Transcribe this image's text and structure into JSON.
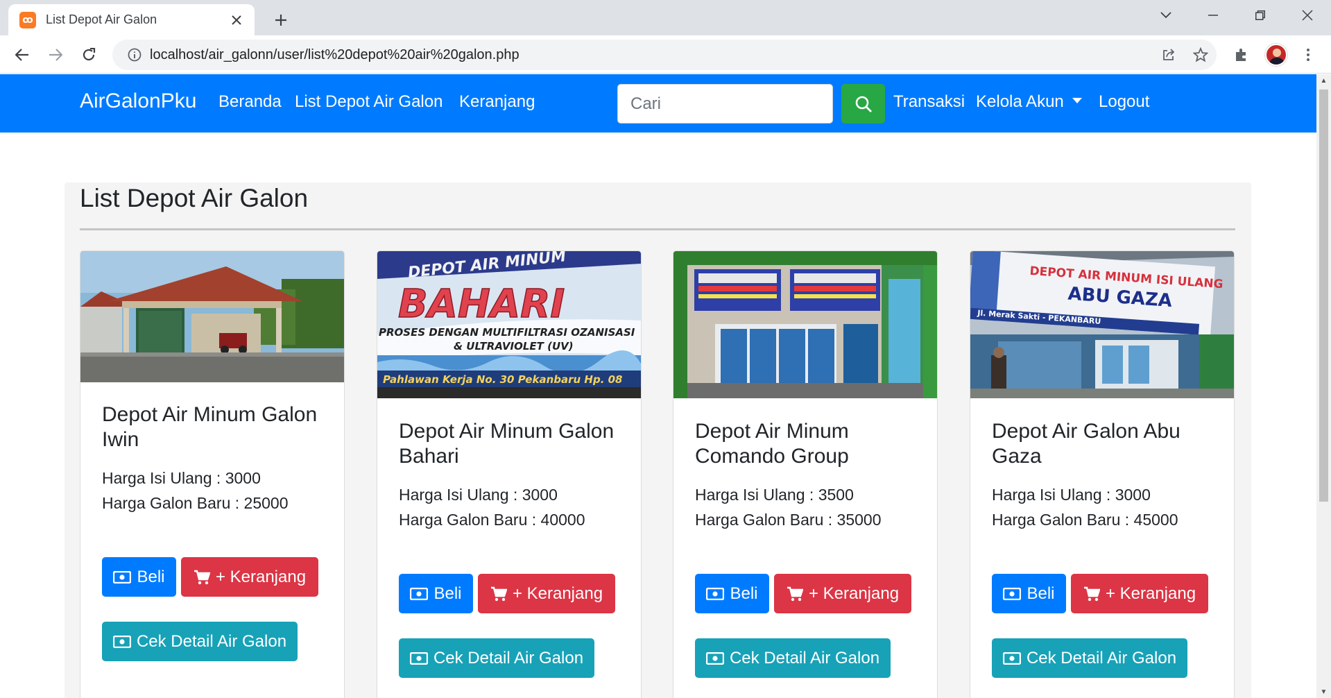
{
  "browser": {
    "tab_title": "List Depot Air Galon",
    "url": "localhost/air_galonn/user/list%20depot%20air%20galon.php"
  },
  "site": {
    "brand": "AirGalonPku",
    "nav": {
      "beranda": "Beranda",
      "list_depot": "List Depot Air Galon",
      "keranjang": "Keranjang",
      "transaksi": "Transaksi",
      "kelola_akun": "Kelola Akun",
      "logout": "Logout"
    },
    "search": {
      "placeholder": "Cari"
    }
  },
  "page": {
    "title": "List Depot Air Galon",
    "buttons": {
      "beli": "Beli",
      "keranjang": "+ Keranjang",
      "detail": "Cek Detail Air Galon"
    },
    "depots": [
      {
        "name": "Depot Air Minum Galon Iwin",
        "isi_ulang": "Harga Isi Ulang : 3000",
        "galon_baru": "Harga Galon Baru : 25000"
      },
      {
        "name": "Depot Air Minum Galon Bahari",
        "isi_ulang": "Harga Isi Ulang : 3000",
        "galon_baru": "Harga Galon Baru : 40000",
        "sign_line1": "DEPOT AIR MINUM",
        "sign_line2": "BAHARI",
        "sign_line3": "PROSES DENGAN MULTIFILTRASI OZANISASI",
        "sign_line4": "& ULTRAVIOLET (UV)",
        "sign_line5": "Pahlawan Kerja No. 30 Pekanbaru Hp. 08"
      },
      {
        "name": "Depot Air Minum Comando Group",
        "isi_ulang": "Harga Isi Ulang : 3500",
        "galon_baru": "Harga Galon Baru : 35000"
      },
      {
        "name": "Depot Air Galon Abu Gaza",
        "isi_ulang": "Harga Isi Ulang : 3000",
        "galon_baru": "Harga Galon Baru : 45000",
        "sign_line1": "DEPOT AIR MINUM ISI ULANG",
        "sign_line2": "ABU GAZA",
        "sign_line3": "Jl. Merak Sakti - PEKANBARU"
      }
    ]
  }
}
